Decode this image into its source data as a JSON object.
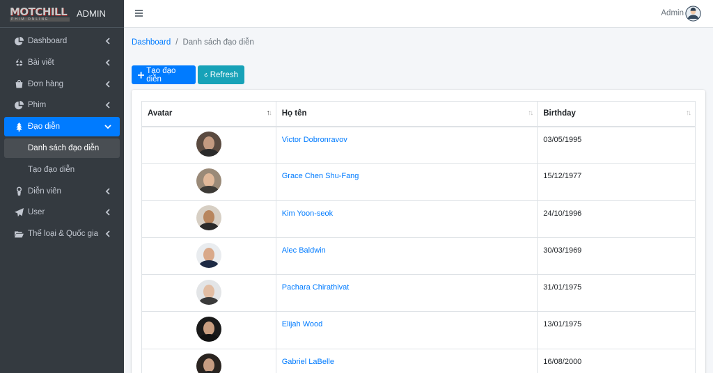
{
  "brand": {
    "logo_main": "MOTCHILL",
    "logo_sub": "PHIM ONLINE",
    "title": "ADMIN"
  },
  "topbar": {
    "user": "Admin"
  },
  "sidebar": {
    "items": [
      {
        "label": "Dashboard",
        "icon": "pie-chart-icon"
      },
      {
        "label": "Bài viết",
        "icon": "recycle-icon"
      },
      {
        "label": "Đơn hàng",
        "icon": "shopping-bag-icon"
      },
      {
        "label": "Phim",
        "icon": "pie-chart-icon"
      },
      {
        "label": "Đạo diễn",
        "icon": "tree-icon"
      },
      {
        "label": "Diễn viên",
        "icon": "user-icon"
      },
      {
        "label": "User",
        "icon": "paper-plane-icon"
      },
      {
        "label": "Thể loại & Quốc gia",
        "icon": "folder-open-icon"
      }
    ],
    "sub_items": [
      {
        "label": "Danh sách đạo diễn"
      },
      {
        "label": "Tạo đạo diễn"
      }
    ]
  },
  "breadcrumb": {
    "home": "Dashboard",
    "current": "Danh sách đạo diễn"
  },
  "actions": {
    "create": "Tạo đạo diễn",
    "refresh": "Refresh"
  },
  "table": {
    "headers": {
      "avatar": "Avatar",
      "name": "Họ tên",
      "birthday": "Birthday"
    },
    "rows": [
      {
        "name": "Victor Dobronravov",
        "birthday": "03/05/1995"
      },
      {
        "name": "Grace Chen Shu-Fang",
        "birthday": "15/12/1977"
      },
      {
        "name": "Kim Yoon-seok",
        "birthday": "24/10/1996"
      },
      {
        "name": "Alec Baldwin",
        "birthday": "30/03/1969"
      },
      {
        "name": "Pachara Chirathivat",
        "birthday": "31/01/1975"
      },
      {
        "name": "Elijah Wood",
        "birthday": "13/01/1975"
      },
      {
        "name": "Gabriel LaBelle",
        "birthday": "16/08/2000"
      }
    ]
  },
  "colors": {
    "primary": "#007bff",
    "info": "#17a2b8",
    "sidebar": "#343a40"
  }
}
